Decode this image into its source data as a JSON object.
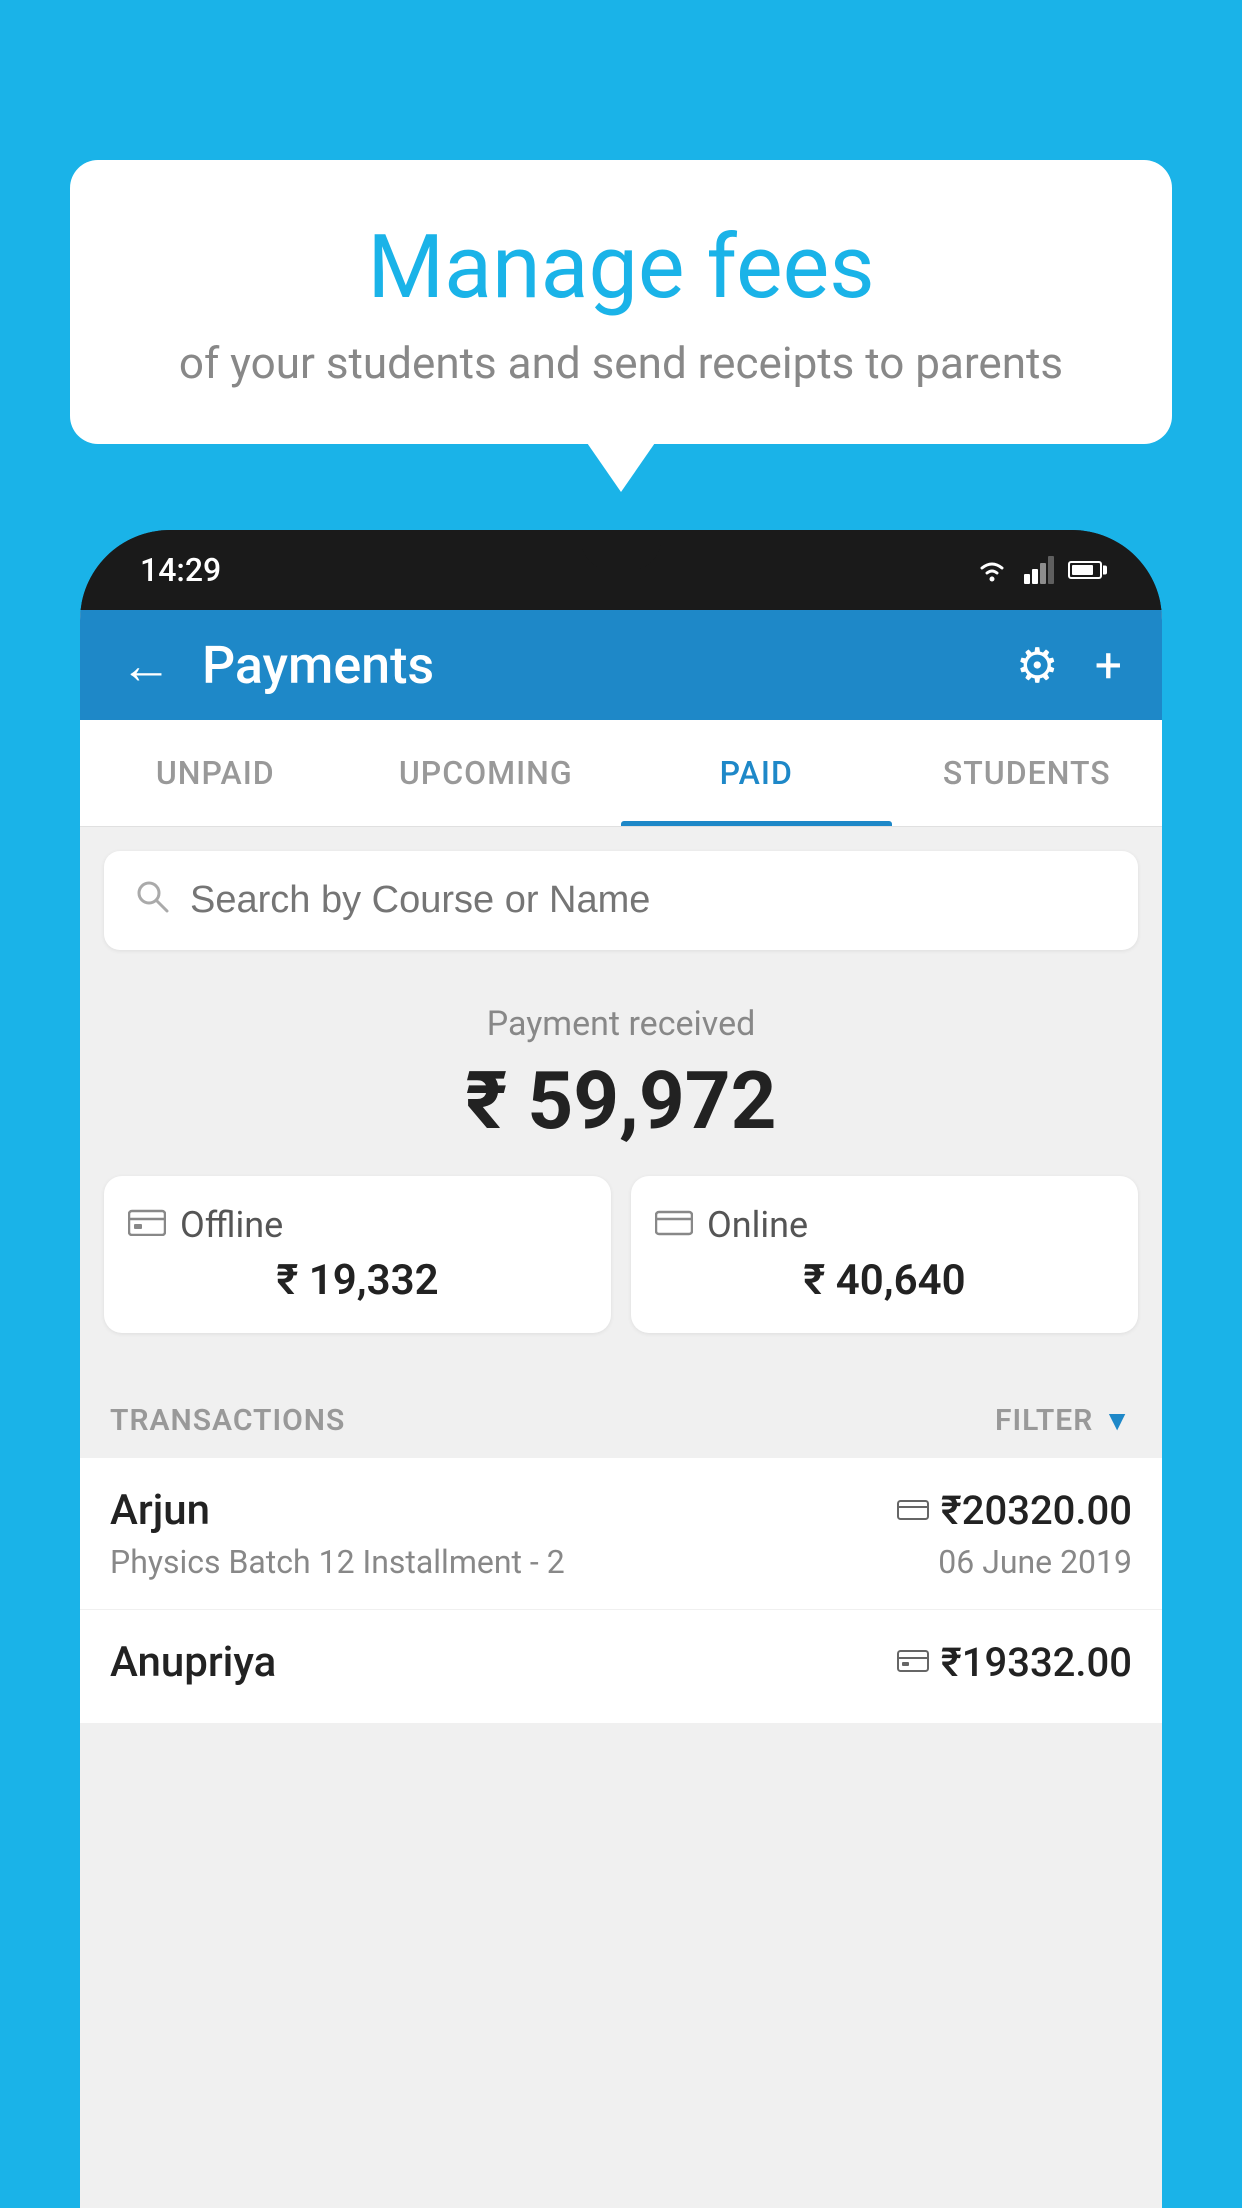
{
  "background_color": "#1ab3e8",
  "bubble": {
    "title": "Manage fees",
    "subtitle": "of your students and send receipts to parents"
  },
  "phone": {
    "time": "14:29",
    "header": {
      "title": "Payments",
      "back_label": "←",
      "settings_label": "⚙",
      "add_label": "+"
    },
    "tabs": [
      {
        "label": "UNPAID",
        "active": false
      },
      {
        "label": "UPCOMING",
        "active": false
      },
      {
        "label": "PAID",
        "active": true
      },
      {
        "label": "STUDENTS",
        "active": false
      }
    ],
    "search": {
      "placeholder": "Search by Course or Name"
    },
    "payment": {
      "received_label": "Payment received",
      "total_amount": "₹ 59,972",
      "offline": {
        "label": "Offline",
        "amount": "₹ 19,332"
      },
      "online": {
        "label": "Online",
        "amount": "₹ 40,640"
      }
    },
    "transactions": {
      "label": "TRANSACTIONS",
      "filter_label": "FILTER",
      "items": [
        {
          "name": "Arjun",
          "amount": "₹20320.00",
          "description": "Physics Batch 12 Installment - 2",
          "date": "06 June 2019",
          "payment_type": "online"
        },
        {
          "name": "Anupriya",
          "amount": "₹19332.00",
          "description": "",
          "date": "",
          "payment_type": "offline"
        }
      ]
    }
  }
}
